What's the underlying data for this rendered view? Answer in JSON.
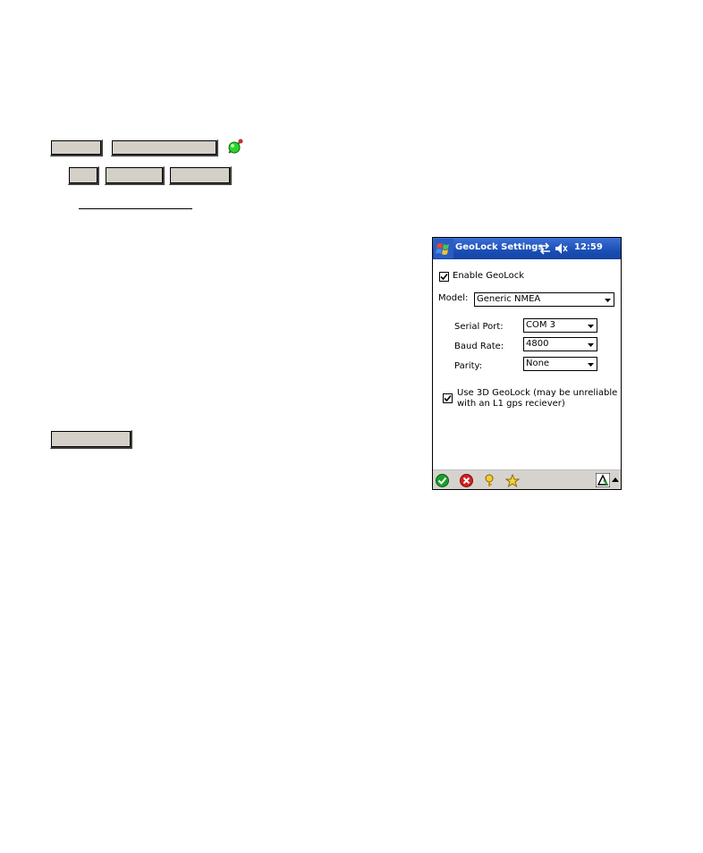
{
  "window": {
    "title": "GeoLock Settings",
    "clock": "12:59",
    "icons": [
      "windows-start-icon",
      "sync-arrows-icon",
      "speaker-muted-icon"
    ]
  },
  "settings": {
    "enable_geolock": {
      "label": "Enable GeoLock",
      "checked": true
    },
    "model": {
      "label": "Model:",
      "value": "Generic NMEA"
    },
    "serial_port": {
      "label": "Serial Port:",
      "value": "COM 3"
    },
    "baud_rate": {
      "label": "Baud Rate:",
      "value": "4800"
    },
    "parity": {
      "label": "Parity:",
      "value": "None"
    },
    "use_3d": {
      "line1": "Use 3D GeoLock (may be unreliable",
      "line2": "with an L1 gps reciever)",
      "checked": true
    }
  },
  "command_bar": {
    "icons": [
      "ok-check-icon",
      "cancel-x-icon",
      "help-key-icon",
      "favorite-star-icon",
      "input-panel-icon",
      "up-arrow-icon"
    ]
  },
  "colors": {
    "titlebar": "#1a4fb5",
    "command_bar": "#d6d3ce",
    "ok_green": "#1a9e2a",
    "cancel_red": "#d42020"
  }
}
